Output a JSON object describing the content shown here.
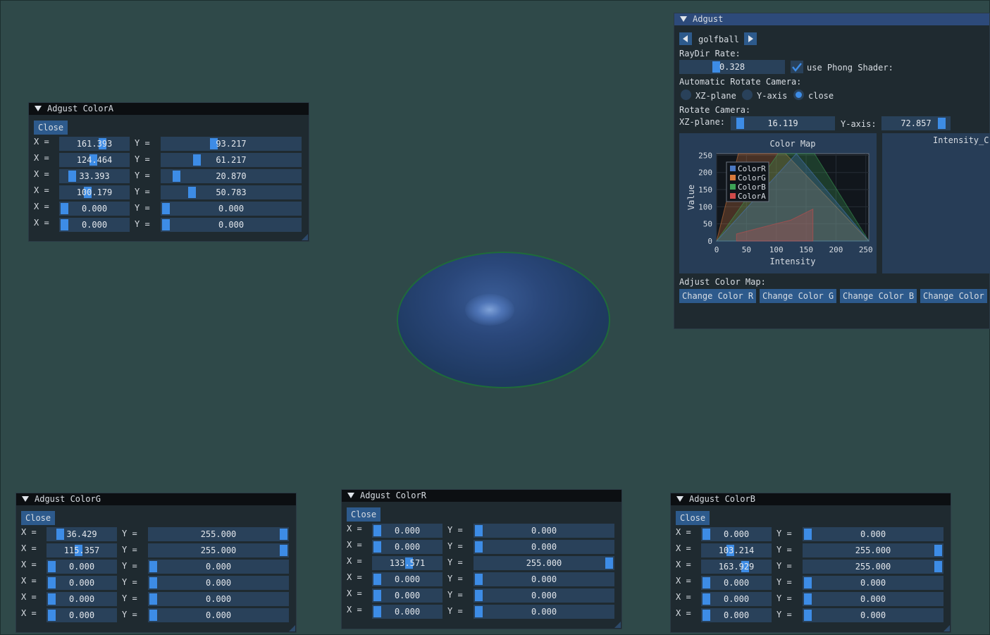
{
  "scene": {
    "object": "golfball"
  },
  "adjust_panel": {
    "title": "Adgust",
    "model_name": "golfball",
    "raydir_label": "RayDir Rate:",
    "raydir_value": "0.328",
    "raydir_fraction": 0.33,
    "phong_label": "use Phong Shader:",
    "phong_checked": true,
    "auto_rotate_label": "Automatic Rotate Camera:",
    "auto_rotate_options": [
      "XZ-plane",
      "Y-axis",
      "close"
    ],
    "auto_rotate_selected": "close",
    "rotate_label": "Rotate Camera:",
    "xz_label": "XZ-plane:",
    "xz_value": "16.119",
    "yaxis_label": "Y-axis:",
    "yaxis_value": "72.857",
    "second_plot_title": "Intensity_C",
    "adjust_map_label": "Adjust Color Map:",
    "change_buttons": [
      "Change Color R",
      "Change Color G",
      "Change Color B",
      "Change Color"
    ]
  },
  "chart_data": {
    "type": "area",
    "title": "Color Map",
    "xlabel": "Intensity",
    "ylabel": "Value",
    "xlim": [
      0,
      255
    ],
    "ylim": [
      0,
      255
    ],
    "x_ticks": [
      "0",
      "50",
      "100",
      "150",
      "200",
      "250"
    ],
    "y_ticks": [
      "250",
      "200",
      "150",
      "100",
      "50",
      "0"
    ],
    "legend_position": "top-left",
    "series": [
      {
        "name": "ColorR",
        "color": "#4a78c2",
        "points": [
          [
            0,
            0
          ],
          [
            133.571,
            255
          ],
          [
            255,
            0
          ]
        ]
      },
      {
        "name": "ColorG",
        "color": "#d97a3c",
        "points": [
          [
            0,
            0
          ],
          [
            36.429,
            255
          ],
          [
            115.357,
            255
          ],
          [
            255,
            0
          ]
        ]
      },
      {
        "name": "ColorB",
        "color": "#3da356",
        "points": [
          [
            0,
            0
          ],
          [
            103.214,
            255
          ],
          [
            163.929,
            255
          ],
          [
            255,
            0
          ]
        ]
      },
      {
        "name": "ColorA",
        "color": "#cf4a4a",
        "points": [
          [
            33.393,
            20.87
          ],
          [
            100.179,
            50.783
          ],
          [
            124.464,
            61.217
          ],
          [
            161.393,
            93.217
          ]
        ]
      }
    ]
  },
  "panel_a": {
    "title": "Adgust ColorA",
    "close": "Close",
    "rows": [
      {
        "x": "161.393",
        "y": "93.217",
        "xf": 0.633,
        "yf": 0.366
      },
      {
        "x": "124.464",
        "y": "61.217",
        "xf": 0.488,
        "yf": 0.24
      },
      {
        "x": "33.393",
        "y": "20.870",
        "xf": 0.131,
        "yf": 0.082
      },
      {
        "x": "100.179",
        "y": "50.783",
        "xf": 0.393,
        "yf": 0.199
      },
      {
        "x": "0.000",
        "y": "0.000",
        "xf": 0,
        "yf": 0
      },
      {
        "x": "0.000",
        "y": "0.000",
        "xf": 0,
        "yf": 0
      }
    ]
  },
  "panel_g": {
    "title": "Adgust ColorG",
    "close": "Close",
    "rows": [
      {
        "x": "36.429",
        "y": "255.000",
        "xf": 0.143,
        "yf": 1
      },
      {
        "x": "115.357",
        "y": "255.000",
        "xf": 0.452,
        "yf": 1
      },
      {
        "x": "0.000",
        "y": "0.000",
        "xf": 0,
        "yf": 0
      },
      {
        "x": "0.000",
        "y": "0.000",
        "xf": 0,
        "yf": 0
      },
      {
        "x": "0.000",
        "y": "0.000",
        "xf": 0,
        "yf": 0
      },
      {
        "x": "0.000",
        "y": "0.000",
        "xf": 0,
        "yf": 0
      }
    ]
  },
  "panel_r": {
    "title": "Adgust ColorR",
    "close": "Close",
    "rows": [
      {
        "x": "0.000",
        "y": "0.000",
        "xf": 0,
        "yf": 0
      },
      {
        "x": "0.000",
        "y": "0.000",
        "xf": 0,
        "yf": 0
      },
      {
        "x": "133.571",
        "y": "255.000",
        "xf": 0.524,
        "yf": 1
      },
      {
        "x": "0.000",
        "y": "0.000",
        "xf": 0,
        "yf": 0
      },
      {
        "x": "0.000",
        "y": "0.000",
        "xf": 0,
        "yf": 0
      },
      {
        "x": "0.000",
        "y": "0.000",
        "xf": 0,
        "yf": 0
      }
    ]
  },
  "panel_b": {
    "title": "Adgust ColorB",
    "close": "Close",
    "rows": [
      {
        "x": "0.000",
        "y": "0.000",
        "xf": 0,
        "yf": 0
      },
      {
        "x": "103.214",
        "y": "255.000",
        "xf": 0.405,
        "yf": 1
      },
      {
        "x": "163.929",
        "y": "255.000",
        "xf": 0.643,
        "yf": 1
      },
      {
        "x": "0.000",
        "y": "0.000",
        "xf": 0,
        "yf": 0
      },
      {
        "x": "0.000",
        "y": "0.000",
        "xf": 0,
        "yf": 0
      },
      {
        "x": "0.000",
        "y": "0.000",
        "xf": 0,
        "yf": 0
      }
    ]
  },
  "labels": {
    "x": "X =",
    "y": "Y ="
  }
}
